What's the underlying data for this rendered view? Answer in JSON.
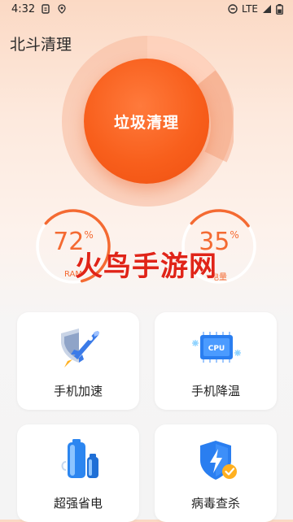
{
  "status_bar": {
    "time": "4:32",
    "network": "LTE"
  },
  "app": {
    "title": "北斗清理"
  },
  "main_button": {
    "label": "垃圾清理"
  },
  "gauges": {
    "ram": {
      "value": "72",
      "unit": "%",
      "label": "RAM",
      "fraction": 0.72
    },
    "battery": {
      "value": "35",
      "unit": "%",
      "label": "电量",
      "fraction": 0.35
    }
  },
  "watermark": "火鸟手游网",
  "features": [
    {
      "label": "手机加速",
      "icon": "rocket-shield-icon"
    },
    {
      "label": "手机降温",
      "icon": "cpu-cooling-icon"
    },
    {
      "label": "超强省电",
      "icon": "battery-icon"
    },
    {
      "label": "病毒查杀",
      "icon": "shield-lightning-icon"
    }
  ],
  "colors": {
    "accent": "#f85f1c",
    "gauge_track": "#ffffff",
    "watermark": "#e02418"
  }
}
